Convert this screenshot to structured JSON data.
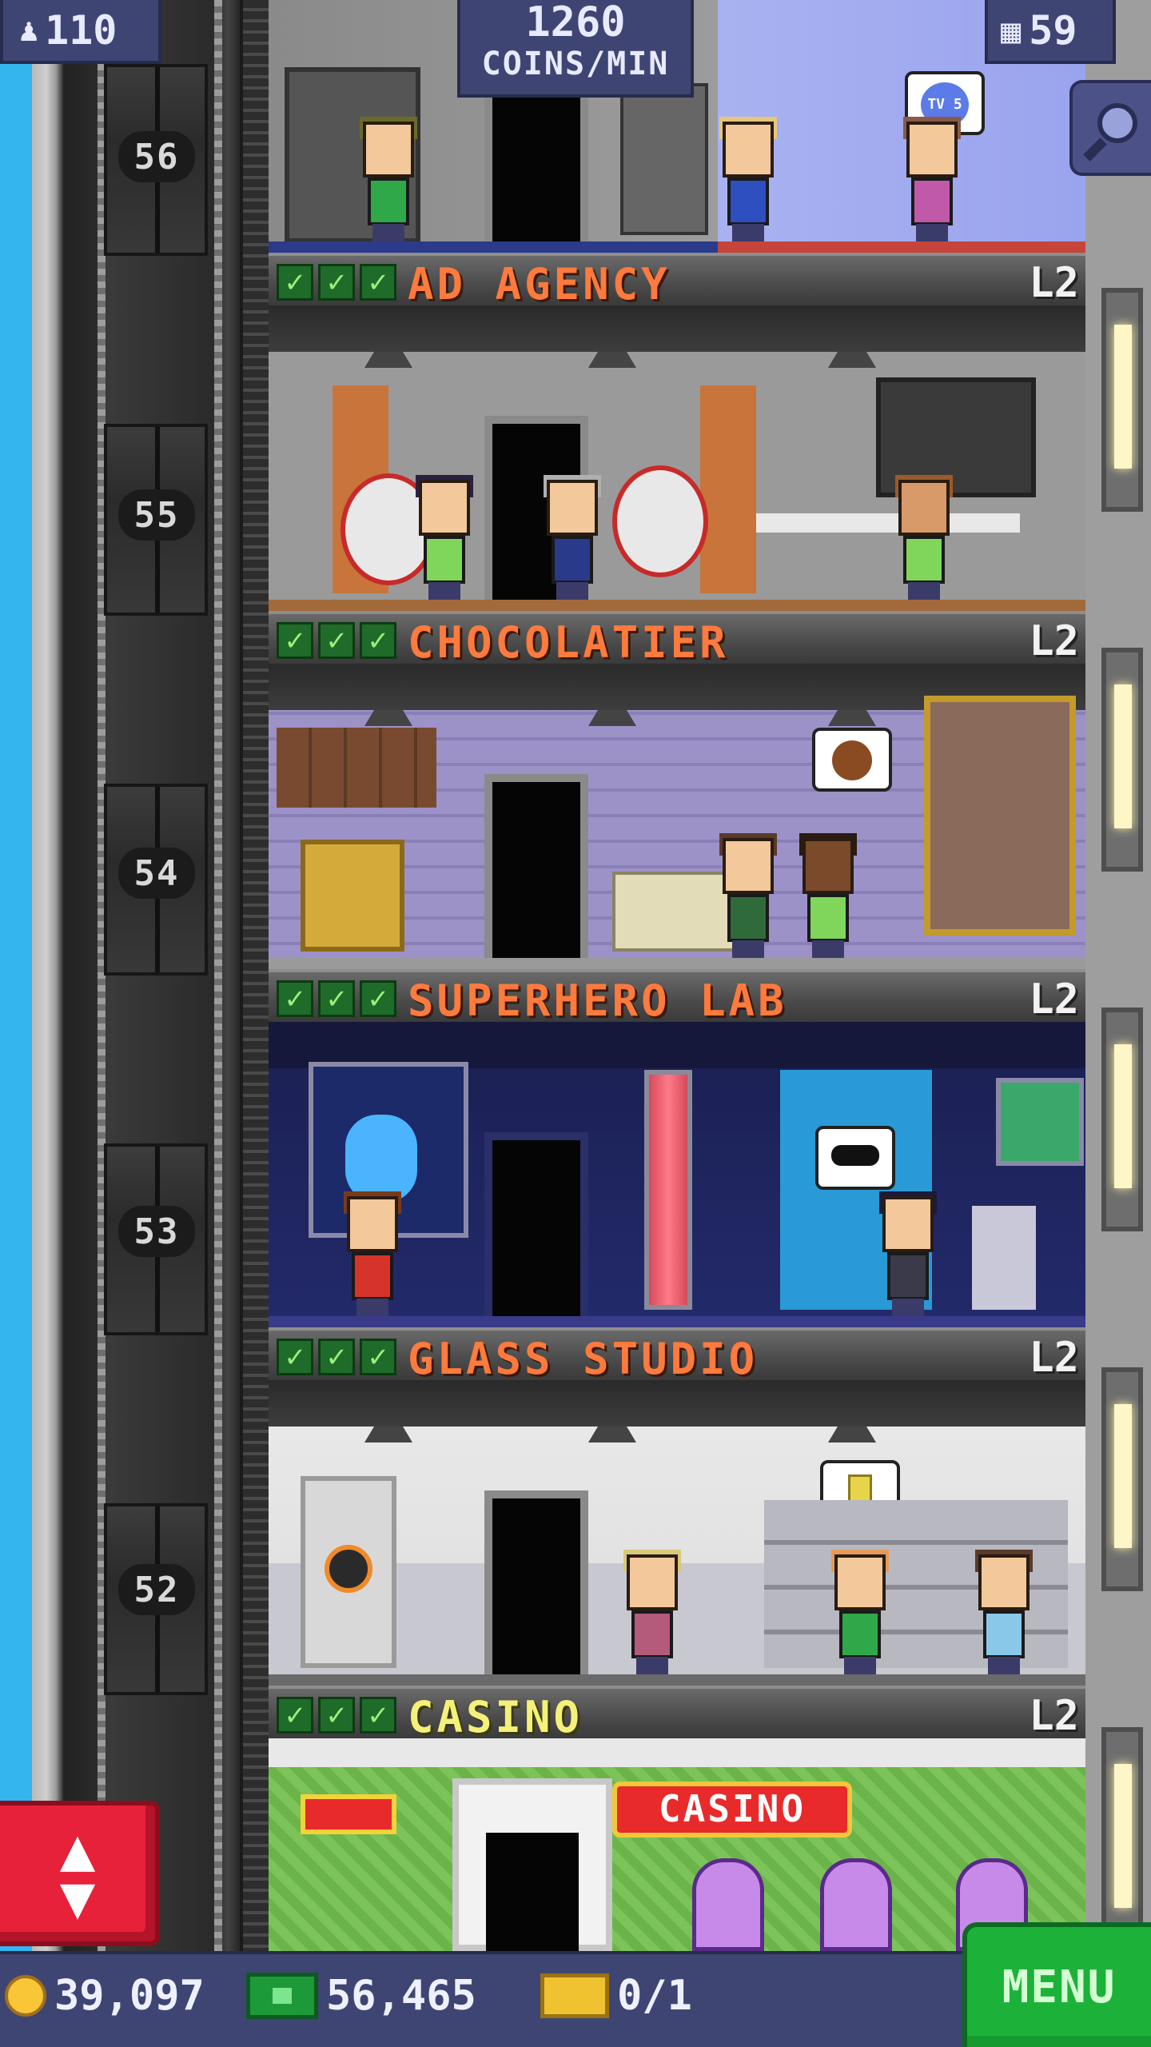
{
  "hud": {
    "population": "110",
    "coins_per_min_value": "1260",
    "coins_per_min_label": "COINS/MIN",
    "floor_count": "59"
  },
  "shaft": {
    "floor_numbers": [
      "56",
      "55",
      "54",
      "53",
      "52"
    ]
  },
  "floors": [
    {
      "name": "AD AGENCY",
      "level": "L2",
      "stocked": 3
    },
    {
      "name": "CHOCOLATIER",
      "level": "L2",
      "stocked": 3
    },
    {
      "name": "SUPERHERO LAB",
      "level": "L2",
      "stocked": 3
    },
    {
      "name": "GLASS STUDIO",
      "level": "L2",
      "stocked": 3
    },
    {
      "name": "CASINO",
      "level": "L2",
      "stocked": 3
    }
  ],
  "signs": {
    "tv_bubble": "TV 5",
    "casino_sign": "CASINO"
  },
  "bottom_bar": {
    "coins": "39,097",
    "bux": "56,465",
    "vip": "0/1",
    "menu_label": "MENU"
  },
  "icons": {
    "population": "person-icon",
    "floors": "building-icon",
    "search": "magnifier-icon",
    "elevator": "up-down-arrows-icon",
    "coin": "coin-icon",
    "bux": "bux-icon",
    "vip": "ticket-icon",
    "stock": "check-icon"
  },
  "colors": {
    "hud_panel": "#3f4573",
    "floor_title": "#ff7a3d",
    "casino_title": "#f4f07a",
    "menu_green": "#1cb23a",
    "elevator_red": "#e8213b"
  }
}
